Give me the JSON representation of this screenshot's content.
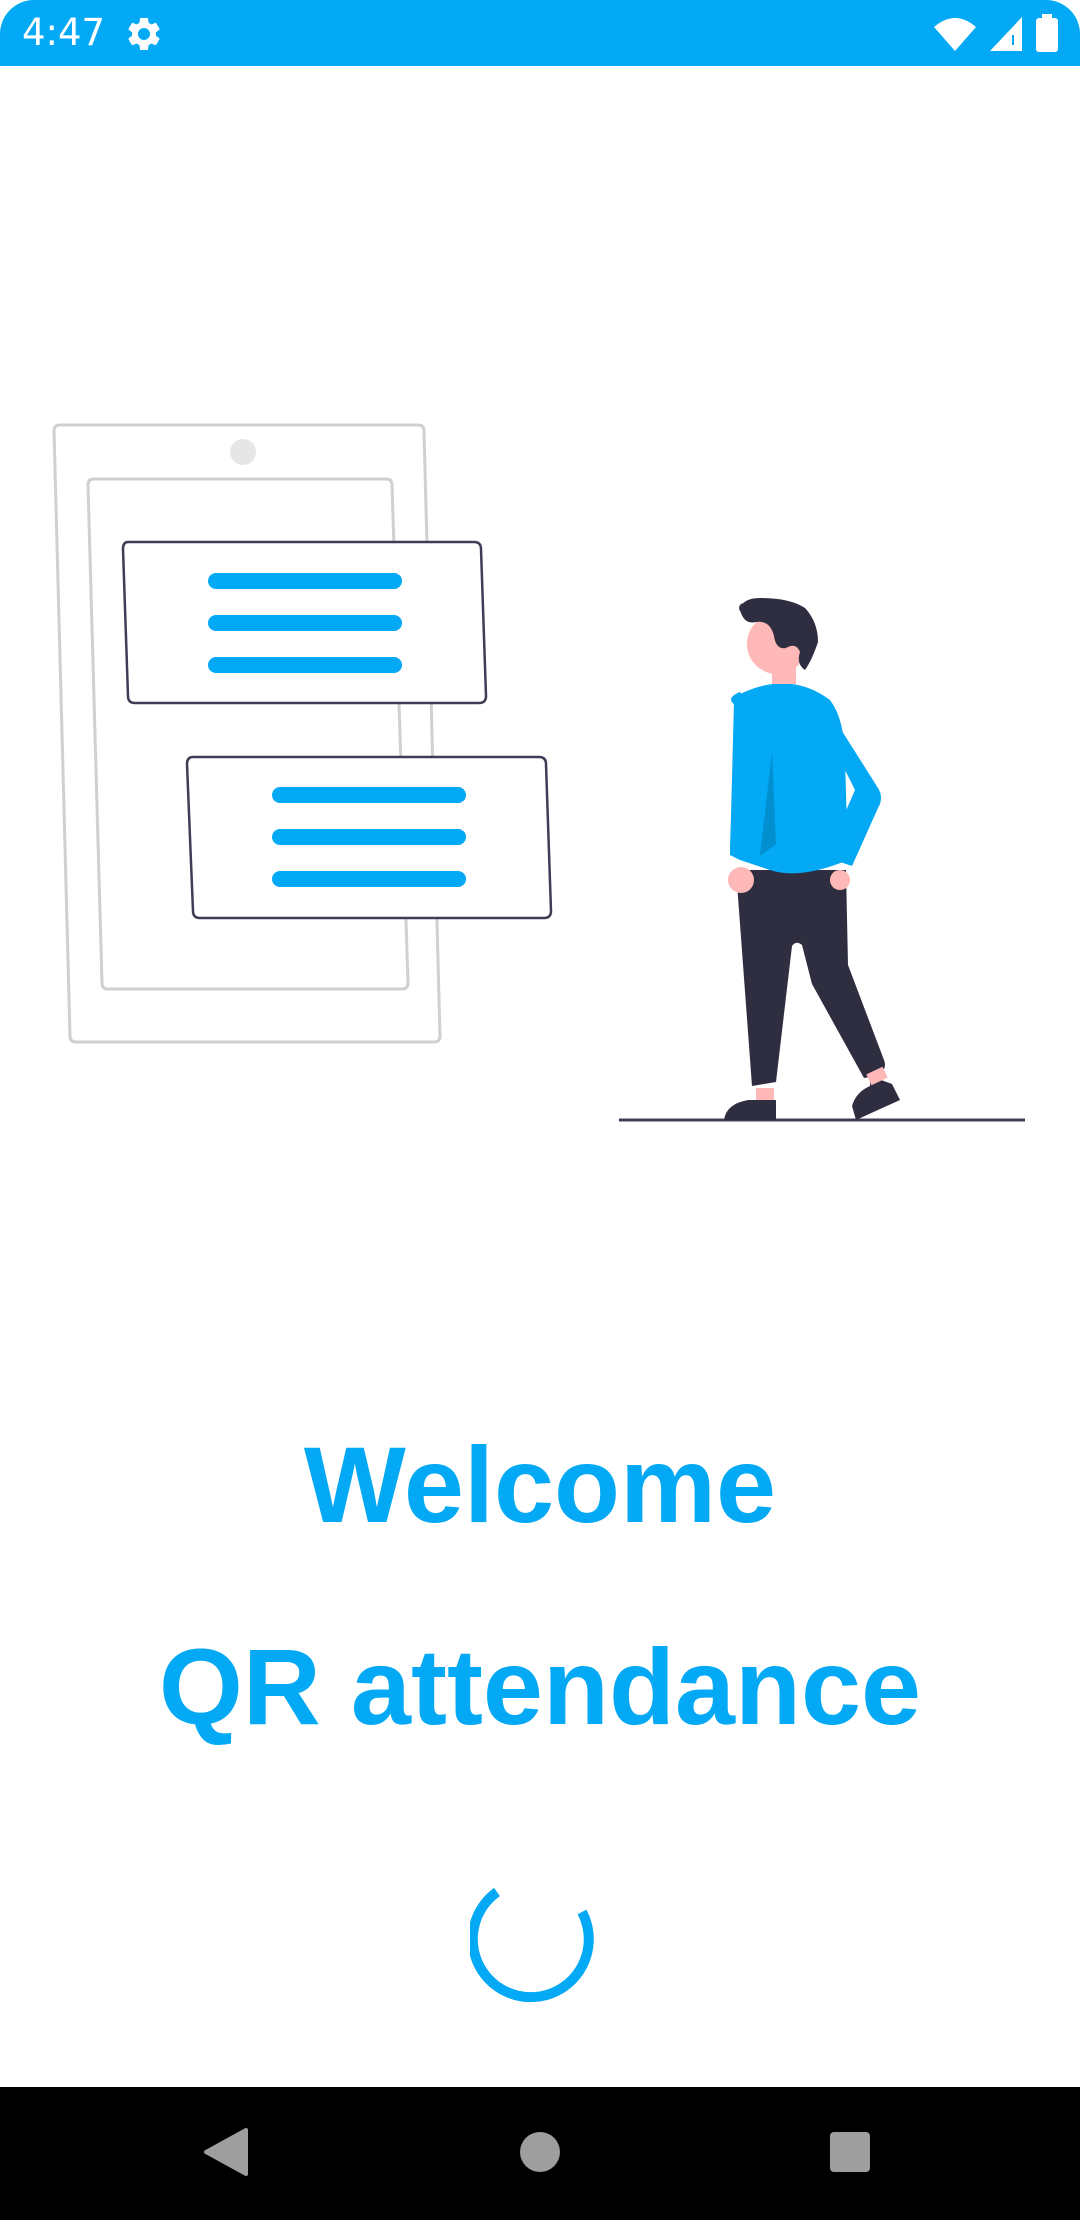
{
  "status_bar": {
    "time": "4:47",
    "background_color": "#03A9F4",
    "icons": [
      "gear-icon",
      "wifi-icon",
      "signal-icon",
      "battery-icon"
    ]
  },
  "illustration": {
    "name": "person-looking-at-phone-chat",
    "accent_color": "#03A9F4"
  },
  "main": {
    "welcome": "Welcome",
    "app_name": "QR attendance",
    "text_color": "#03A9F4"
  },
  "loading": {
    "indicator": "progress-spinner"
  },
  "nav_bar": {
    "buttons": [
      "back-icon",
      "home-icon",
      "recents-icon"
    ]
  }
}
